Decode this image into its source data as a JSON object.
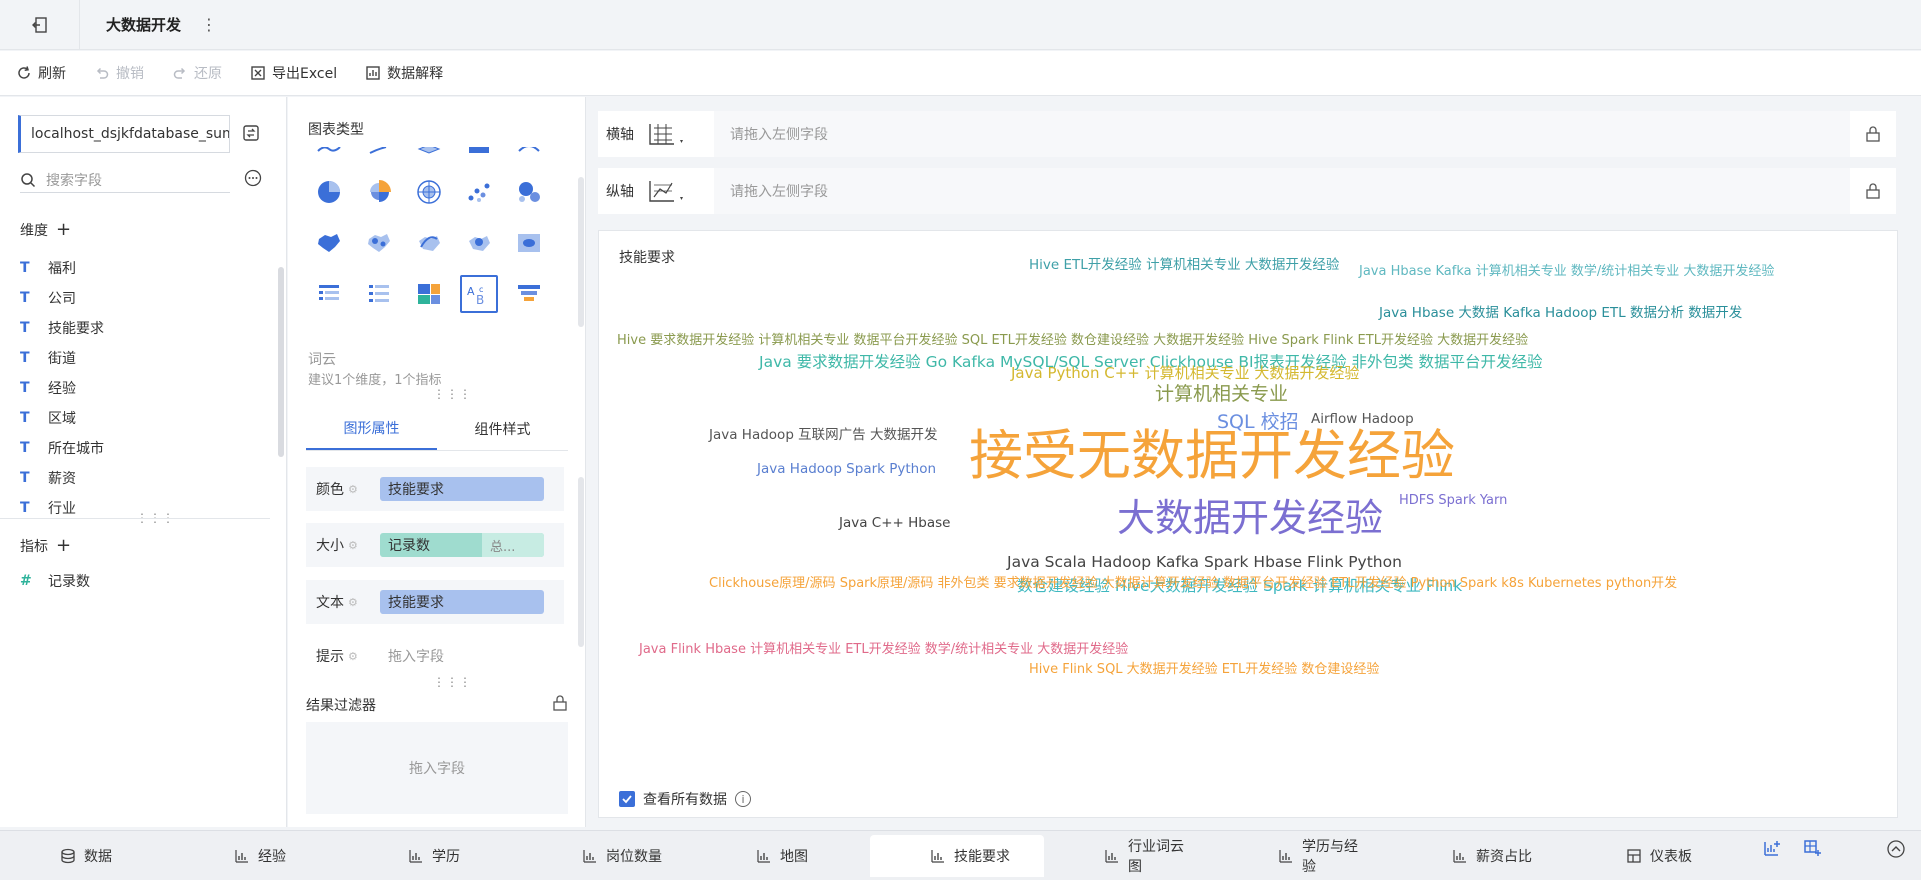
{
  "app": {
    "title": "大数据开发"
  },
  "toolbar": {
    "refresh": "刷新",
    "undo": "撤销",
    "redo": "还原",
    "export_excel": "导出Excel",
    "data_explain": "数据解释"
  },
  "fields": {
    "datasource": "localhost_dsjkfdatabase_sum",
    "search_placeholder": "搜索字段",
    "dimension_title": "维度",
    "measure_title": "指标",
    "dimensions": [
      "福利",
      "公司",
      "技能要求",
      "街道",
      "经验",
      "区域",
      "所在城市",
      "薪资",
      "行业"
    ],
    "measures": [
      "记录数"
    ]
  },
  "config": {
    "chart_type_title": "图表类型",
    "chart_name": "词云",
    "chart_hint": "建议1个维度，1个指标",
    "tab_props": "图形属性",
    "tab_style": "组件样式",
    "props": {
      "color_label": "颜色",
      "color_value": "技能要求",
      "size_label": "大小",
      "size_value": "记录数",
      "size_agg": "总...",
      "text_label": "文本",
      "text_value": "技能要求",
      "tip_label": "提示",
      "tip_value": "拖入字段"
    },
    "filter_title": "结果过滤器",
    "filter_placeholder": "拖入字段"
  },
  "axes": {
    "x_label": "横轴",
    "y_label": "纵轴",
    "x_placeholder": "请拖入左侧字段",
    "y_placeholder": "请拖入左侧字段"
  },
  "chart": {
    "title": "技能要求",
    "view_all": "查看所有数据"
  },
  "colors": {
    "accent": "#3b6fd8",
    "measure": "#2eb39b"
  },
  "chart_data": {
    "type": "wordcloud",
    "title": "技能要求",
    "words": [
      {
        "text": "接受无数据开发经验",
        "weight": 100,
        "color": "#f5a33a"
      },
      {
        "text": "大数据开发经验",
        "weight": 62,
        "color": "#7b6fd1"
      },
      {
        "text": "SQL 校招",
        "weight": 24,
        "color": "#6b8fe0"
      },
      {
        "text": "计算机相关专业",
        "weight": 22,
        "color": "#8a9a4e"
      },
      {
        "text": "Java 要求数据开发经验 Go Kafka MySQL/SQL Server Clickhouse BI报表开发经验 非外包类 数据平台开发经验",
        "weight": 18,
        "color": "#3fb8a8"
      },
      {
        "text": "Java Scala Hadoop Kafka Spark Hbase Flink Python",
        "weight": 16,
        "color": "#444444"
      },
      {
        "text": "数仓建设经验 Hive大数据开发经验 Spark 计算机相关专业 Flink",
        "weight": 16,
        "color": "#3fb8c0"
      },
      {
        "text": "Java Python C++ 计算机相关专业 大数据开发经验",
        "weight": 16,
        "color": "#d4b830"
      },
      {
        "text": "Hive ETL开发经验 计算机相关专业 大数据开发经验",
        "weight": 14,
        "color": "#3fa0a8"
      },
      {
        "text": "Java Hbase Kafka 计算机相关专业 数学/统计相关专业 大数据开发经验",
        "weight": 14,
        "color": "#5fb8c0"
      },
      {
        "text": "Java Hbase 大数据 Kafka Hadoop ETL 数据分析 数据开发",
        "weight": 14,
        "color": "#2a8f9a"
      },
      {
        "text": "Java Hadoop 互联网广告 大数据开发",
        "weight": 14,
        "color": "#555555"
      },
      {
        "text": "Java Hadoop Spark Python",
        "weight": 14,
        "color": "#5a7fd0"
      },
      {
        "text": "Hive 要求数据开发经验 计算机相关专业 数据平台开发经验 SQL ETL开发经验 数仓建设经验 大数据开发经验 Hive Spark Flink ETL开发经验 大数据开发经验",
        "weight": 14,
        "color": "#8a9a4e"
      },
      {
        "text": "Java Flink Hbase 计算机相关专业 ETL开发经验 数学/统计相关专业 大数据开发经验",
        "weight": 13,
        "color": "#e06a8a"
      },
      {
        "text": "Clickhouse原理/源码 Spark原理/源码 非外包类 要求数据开发经验 大数据计算开发经验 数据平台开发经验 ETL开发经验 Python Spark k8s Kubernetes python开发",
        "weight": 13,
        "color": "#f5a33a"
      },
      {
        "text": "Hive Flink SQL 大数据开发经验 ETL开发经验 数仓建设经验",
        "weight": 13,
        "color": "#f5a33a"
      },
      {
        "text": "Airflow Hadoop",
        "weight": 14,
        "color": "#555555"
      },
      {
        "text": "HDFS Spark Yarn",
        "weight": 13,
        "color": "#7b6fd1"
      },
      {
        "text": "Java C++ Hbase",
        "weight": 13,
        "color": "#444444"
      }
    ]
  },
  "sheets": [
    "数据",
    "经验",
    "学历",
    "岗位数量",
    "地图",
    "技能要求",
    "行业词云图",
    "学历与经验",
    "薪资占比",
    "仪表板"
  ],
  "active_sheet": "技能要求"
}
